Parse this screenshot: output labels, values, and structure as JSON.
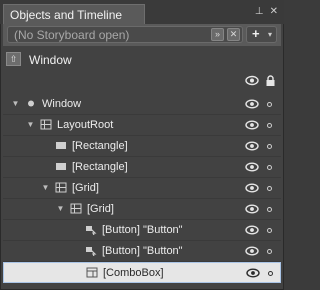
{
  "panel": {
    "tab_title": "Objects and Timeline",
    "pin_glyph": "⊥",
    "close_glyph": "✕"
  },
  "storyboard": {
    "value": "(No Storyboard open)",
    "options_glyph": "»",
    "close_glyph": "✕",
    "add_glyph": "+",
    "caret_glyph": "▾"
  },
  "scope": {
    "label": "Window",
    "icon_glyph": "⇧"
  },
  "tree": {
    "rows": [
      {
        "label": "Window",
        "depth": 0,
        "expanded": true,
        "icon": "window-node-icon"
      },
      {
        "label": "LayoutRoot",
        "depth": 1,
        "expanded": true,
        "icon": "grid-icon"
      },
      {
        "label": "[Rectangle]",
        "depth": 2,
        "icon": "rectangle-icon"
      },
      {
        "label": "[Rectangle]",
        "depth": 2,
        "icon": "rectangle-icon"
      },
      {
        "label": "[Grid]",
        "depth": 2,
        "expanded": true,
        "icon": "grid-icon"
      },
      {
        "label": "[Grid]",
        "depth": 3,
        "expanded": true,
        "icon": "grid-icon"
      },
      {
        "label": "[Button] \"Button\"",
        "depth": 4,
        "icon": "button-icon"
      },
      {
        "label": "[Button] \"Button\"",
        "depth": 4,
        "icon": "button-icon"
      },
      {
        "label": "[ComboBox]",
        "depth": 4,
        "selected": true,
        "icon": "combobox-icon"
      }
    ]
  }
}
